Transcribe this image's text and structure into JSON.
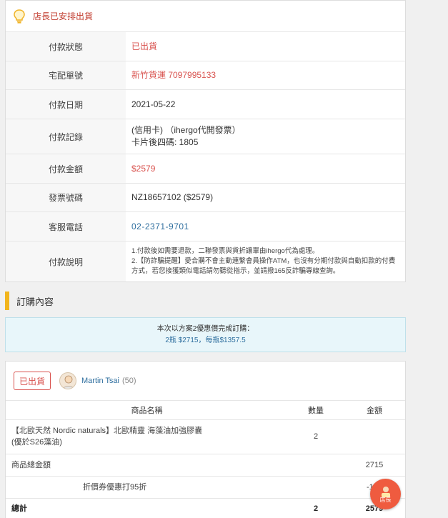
{
  "notice": {
    "text": "店長已安排出貨",
    "icon": "lightbulb-icon"
  },
  "payment": {
    "rows": [
      {
        "label": "付款狀態",
        "value": "已出貨"
      },
      {
        "label": "宅配單號",
        "value": "新竹貨運 7097995133"
      },
      {
        "label": "付款日期",
        "value": "2021-05-22"
      },
      {
        "label": "付款記錄",
        "value": "(信用卡) （ihergo代開發票）",
        "value2": "卡片後四碼: 1805"
      },
      {
        "label": "付款金額",
        "value": "$2579"
      },
      {
        "label": "發票號碼",
        "value": "NZ18657102 ($2579)"
      },
      {
        "label": "客服電話",
        "value": "02-2371-9701"
      },
      {
        "label": "付款說明",
        "value": "1.付款後如需要退款，二聯發票與貨折讓單由ihergo代為處理。",
        "value2": "2.【防詐騙提醒】愛合購不會主動連繫會員操作ATM，也沒有分期付款與自動扣款的付費方式，若您接獲類似電話請勿聽從指示，並請撥165反詐騙專線查詢。"
      }
    ]
  },
  "section": {
    "title": "訂購內容"
  },
  "promo": {
    "line1": "本次以方案2優惠價完成訂購：",
    "line2": "2瓶 $2715，每瓶$1357.5"
  },
  "order": {
    "status": "已出貨",
    "user_name": "Martin Tsai",
    "user_count": "(50)",
    "headers": {
      "name": "商品名稱",
      "qty": "數量",
      "amount": "金額"
    },
    "item": {
      "name_line1": "【北歐天然 Nordic naturals】北歐精靈 海藻油加強膠囊",
      "name_line2": "(優於S26藻油)",
      "qty": "2",
      "amount": ""
    },
    "subtotal": {
      "label": "商品總金額",
      "qty": "",
      "amount": "2715"
    },
    "discount": {
      "label": "折價券優惠打95折",
      "qty": "",
      "amount": "-136"
    },
    "total": {
      "label": "總計",
      "qty": "2",
      "amount": "2579"
    }
  },
  "fab": {
    "label": "店長",
    "icon": "shopkeeper-icon"
  },
  "colors": {
    "accent_red": "#d9534f",
    "link_blue": "#2f6f9f",
    "section_bar": "#f2b51d",
    "promo_bg": "#e8f6fa",
    "fab_bg": "#ef5b3f"
  }
}
